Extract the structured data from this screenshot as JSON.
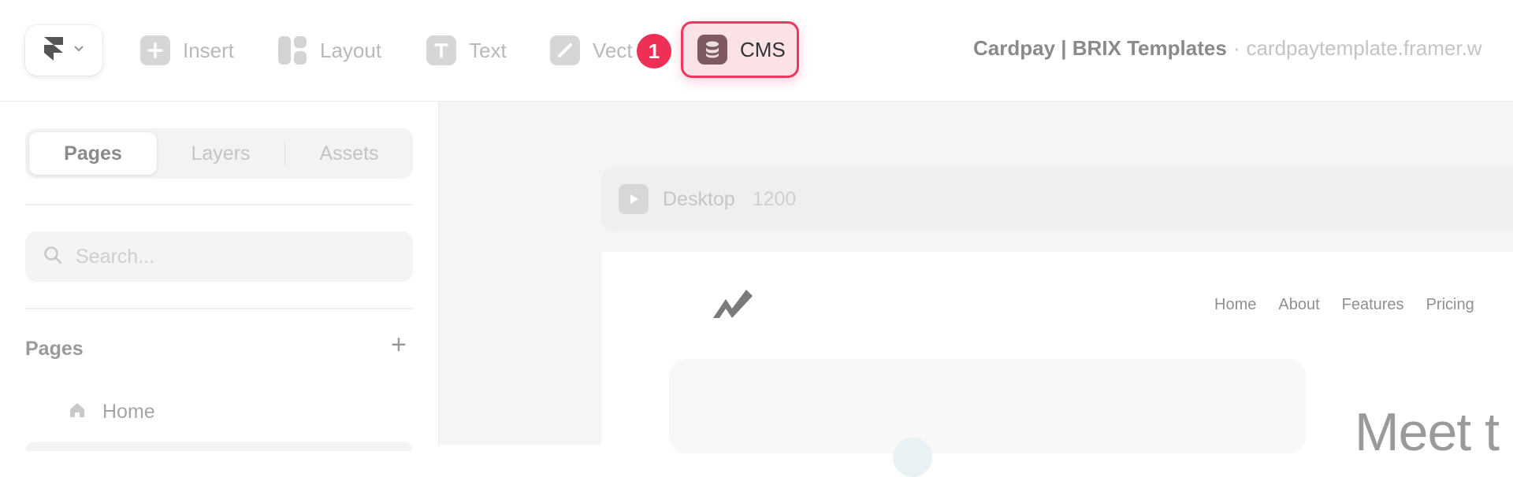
{
  "toolbar": {
    "tools": [
      {
        "label": "Insert",
        "icon": "plus-square-icon"
      },
      {
        "label": "Layout",
        "icon": "layout-icon"
      },
      {
        "label": "Text",
        "icon": "text-icon"
      },
      {
        "label": "Vect",
        "icon": "vector-pen-icon"
      }
    ],
    "cms_label": "CMS",
    "step_number": "1",
    "site_name": "Cardpay | BRIX Templates",
    "separator": "·",
    "site_url": "cardpaytemplate.framer.w"
  },
  "sidebar": {
    "tabs": [
      "Pages",
      "Layers",
      "Assets"
    ],
    "active_tab": "Pages",
    "search_placeholder": "Search...",
    "section_title": "Pages",
    "add_symbol": "+",
    "pages": [
      {
        "label": "Home",
        "icon": "home-icon"
      }
    ]
  },
  "canvas": {
    "frame_name": "Desktop",
    "frame_width": "1200",
    "nav": [
      "Home",
      "About",
      "Features",
      "Pricing"
    ],
    "headline": "Meet t"
  },
  "colors": {
    "highlight_border": "#f0365f",
    "highlight_bg": "#fbe2e7",
    "badge": "#ee2f56"
  }
}
